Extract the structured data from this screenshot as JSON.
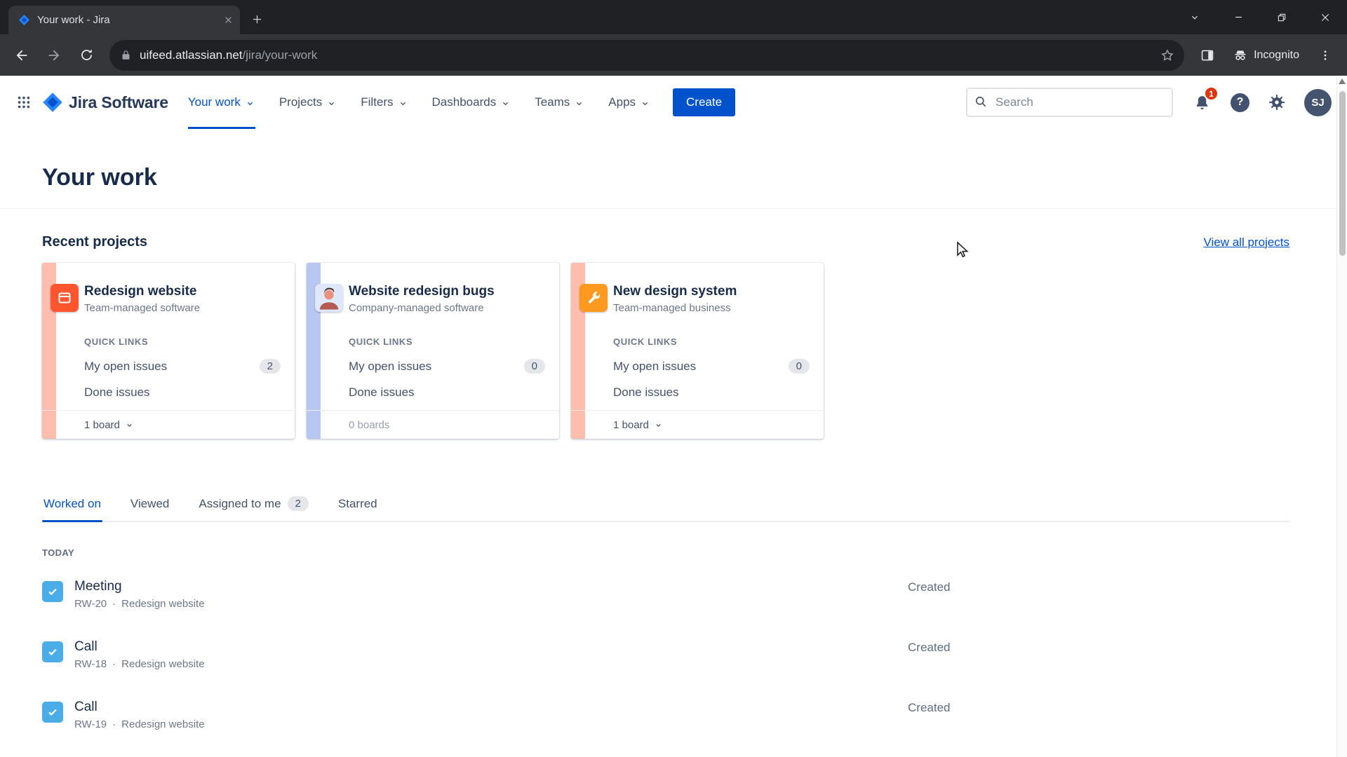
{
  "browser": {
    "tab_title": "Your work - Jira",
    "url_host": "uifeed.atlassian.net",
    "url_path": "/jira/your-work",
    "incognito_label": "Incognito"
  },
  "header": {
    "product_name": "Jira Software",
    "nav": [
      {
        "label": "Your work"
      },
      {
        "label": "Projects"
      },
      {
        "label": "Filters"
      },
      {
        "label": "Dashboards"
      },
      {
        "label": "Teams"
      },
      {
        "label": "Apps"
      }
    ],
    "create_label": "Create",
    "search_placeholder": "Search",
    "notification_badge": "1",
    "help_glyph": "?",
    "avatar_initials": "SJ"
  },
  "page": {
    "title": "Your work",
    "recent": {
      "heading": "Recent projects",
      "view_all_label": "View all projects",
      "quick_links_label": "QUICK LINKS",
      "open_issues_label": "My open issues",
      "done_issues_label": "Done issues",
      "cards": [
        {
          "name": "Redesign website",
          "type": "Team-managed software",
          "open_count": "2",
          "footer": "1 board",
          "stripe": "#FFBDAD",
          "icon": "browser-window-icon",
          "icon_bg": "#FF5630"
        },
        {
          "name": "Website redesign bugs",
          "type": "Company-managed software",
          "open_count": "0",
          "footer": "0 boards",
          "stripe": "#B8C7F2",
          "icon": "person-avatar-icon",
          "icon_bg": "#DFE8FA"
        },
        {
          "name": "New design system",
          "type": "Team-managed business",
          "open_count": "0",
          "footer": "1 board",
          "stripe": "#FFBDAD",
          "icon": "wrench-icon",
          "icon_bg": "#FF991F"
        }
      ]
    },
    "tabs": [
      {
        "label": "Worked on"
      },
      {
        "label": "Viewed"
      },
      {
        "label": "Assigned to me",
        "badge": "2"
      },
      {
        "label": "Starred"
      }
    ],
    "section_heading": "TODAY",
    "dot": "·",
    "items": [
      {
        "title": "Meeting",
        "key": "RW-20",
        "project": "Redesign website",
        "status": "Created"
      },
      {
        "title": "Call",
        "key": "RW-18",
        "project": "Redesign website",
        "status": "Created"
      },
      {
        "title": "Call",
        "key": "RW-19",
        "project": "Redesign website",
        "status": "Created"
      }
    ]
  },
  "colors": {
    "accent": "#0052CC",
    "badge_red": "#DE350B",
    "task_blue": "#4BADE8"
  }
}
